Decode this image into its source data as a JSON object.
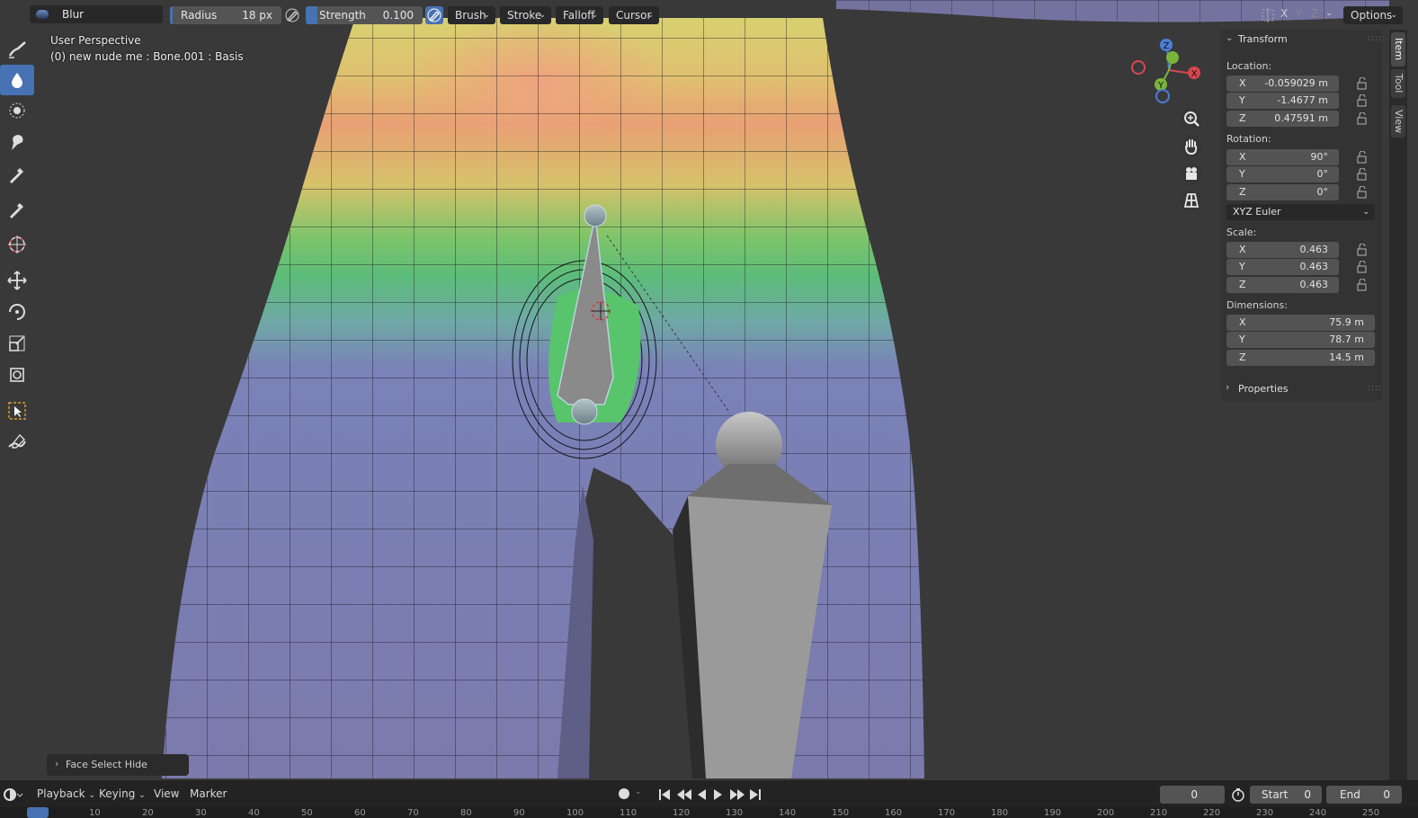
{
  "header": {
    "brush_name": "Blur",
    "radius_label": "Radius",
    "radius_value": "18 px",
    "strength_label": "Strength",
    "strength_value": "0.100",
    "menus": [
      "Brush",
      "Stroke",
      "Falloff",
      "Cursor"
    ],
    "axis_x": "X",
    "axis_y": "Y",
    "axis_z": "Z",
    "options_label": "Options"
  },
  "viewport": {
    "perspective_label": "User Perspective",
    "object_info": "(0) new nude me : Bone.001 : Basis",
    "last_operator": "Face Select Hide",
    "gizmo": {
      "x": "X",
      "y": "Y",
      "z": "Z"
    }
  },
  "toolbar": {
    "tools": [
      "draw-brush-icon",
      "blur-brush-icon",
      "smear-brush-icon",
      "average-brush-icon",
      "sample-weight-icon",
      "gradient-icon",
      "cursor-icon",
      "move-icon",
      "rotate-icon",
      "scale-icon",
      "transform-icon",
      "select-box-icon",
      "annotate-icon"
    ],
    "active_index": 1
  },
  "npanel": {
    "section_title": "Transform",
    "location_label": "Location:",
    "location": [
      {
        "axis": "X",
        "value": "-0.059029 m"
      },
      {
        "axis": "Y",
        "value": "-1.4677 m"
      },
      {
        "axis": "Z",
        "value": "0.47591 m"
      }
    ],
    "rotation_label": "Rotation:",
    "rotation": [
      {
        "axis": "X",
        "value": "90°"
      },
      {
        "axis": "Y",
        "value": "0°"
      },
      {
        "axis": "Z",
        "value": "0°"
      }
    ],
    "rotation_mode": "XYZ Euler",
    "scale_label": "Scale:",
    "scale": [
      {
        "axis": "X",
        "value": "0.463"
      },
      {
        "axis": "Y",
        "value": "0.463"
      },
      {
        "axis": "Z",
        "value": "0.463"
      }
    ],
    "dimensions_label": "Dimensions:",
    "dimensions": [
      {
        "axis": "X",
        "value": "75.9 m"
      },
      {
        "axis": "Y",
        "value": "78.7 m"
      },
      {
        "axis": "Z",
        "value": "14.5 m"
      }
    ],
    "properties_label": "Properties"
  },
  "side_tabs": [
    "Item",
    "Tool",
    "View"
  ],
  "timeline": {
    "menus": [
      "Playback",
      "Keying",
      "View",
      "Marker"
    ],
    "current_frame": "0",
    "start_label": "Start",
    "start_value": "0",
    "end_label": "End",
    "end_value": "0",
    "ruler_ticks": [
      "0",
      "10",
      "20",
      "30",
      "40",
      "50",
      "60",
      "70",
      "80",
      "90",
      "100",
      "110",
      "120",
      "130",
      "140",
      "150",
      "160",
      "170",
      "180",
      "190",
      "200",
      "210",
      "220",
      "230",
      "240",
      "250"
    ]
  },
  "colors": {
    "accent": "#4772b3",
    "panel_bg": "#333333",
    "field_bg": "#545454",
    "viewport_bg": "#393939"
  }
}
